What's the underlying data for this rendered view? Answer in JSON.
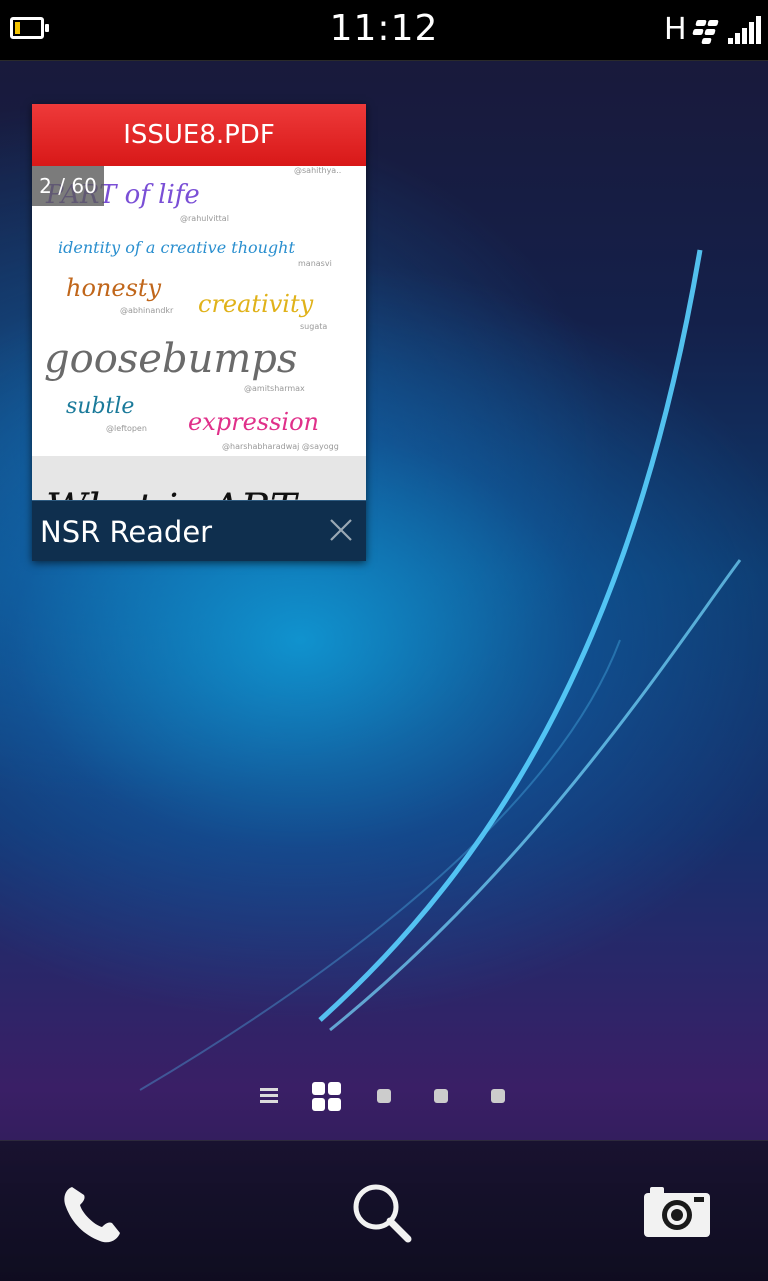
{
  "status_bar": {
    "time": "11:12",
    "network_type": "H",
    "battery_icon": "battery-low-icon",
    "battery_level": 0.2,
    "bbm_icon": "blackberry-logo-icon",
    "signal_icon": "signal-bars-icon",
    "signal_bars": 5
  },
  "active_frame": {
    "document_title": "ISSUE8.PDF",
    "page_indicator": "2 / 60",
    "app_name": "NSR Reader",
    "close_icon": "close-icon",
    "accent_color": "#e32222",
    "page_words": [
      {
        "text": "PART of life",
        "author": "@rahulvittal"
      },
      {
        "text": "identity of a creative thought",
        "author": "manasvi"
      },
      {
        "text": "honesty",
        "author": "@abhinandkr"
      },
      {
        "text": "creativity",
        "author": "sugata"
      },
      {
        "text": "goosebumps",
        "author": "@amitsharmax"
      },
      {
        "text": "subtle",
        "author": "@leftopen"
      },
      {
        "text": "expression",
        "author": "@harshabharadwaj @sayogg"
      }
    ],
    "next_page_peek": "What is ART"
  },
  "pager": {
    "list_icon": "list-view-icon",
    "grid_icon": "active-frames-grid-icon",
    "dots": 3
  },
  "dock": {
    "phone_icon": "phone-icon",
    "search_icon": "search-icon",
    "camera_icon": "camera-icon"
  }
}
